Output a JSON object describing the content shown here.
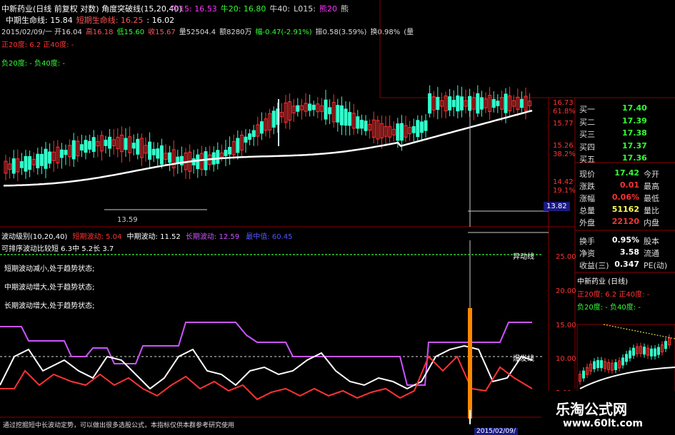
{
  "header": {
    "title": "中新药业(日线 前复权 对数) 角度突破线(15,20,40)",
    "ma_labels": [
      {
        "text": "牛15: 16.53",
        "color": "#ff33ff"
      },
      {
        "text": "牛20: 16.80",
        "color": "#33ff33"
      },
      {
        "text": "牛40:",
        "color": "#dddddd"
      },
      {
        "text": "L015:",
        "color": "#dddddd"
      },
      {
        "text": "熊20",
        "color": "#ff33ff"
      },
      {
        "text": "熊",
        "color": "#dddddd"
      }
    ],
    "line2": [
      {
        "text": "中期生命线: 15.84",
        "color": "#ffffff"
      },
      {
        "text": "短期生命线: 16.25",
        "color": "#ff5555"
      },
      {
        "text": ": 16.02",
        "color": "#ffffff"
      }
    ],
    "ohlc": [
      {
        "text": "2015/02/09/一 开16.04",
        "color": "#dddddd"
      },
      {
        "text": "高16.18",
        "color": "#ff5555"
      },
      {
        "text": "低15.60",
        "color": "#33ff33"
      },
      {
        "text": "收15.67",
        "color": "#ff5555"
      },
      {
        "text": "量52504.4",
        "color": "#dddddd"
      },
      {
        "text": "额8280万",
        "color": "#dddddd"
      },
      {
        "text": "幅-0.47(-2.91%)",
        "color": "#33ff33"
      },
      {
        "text": "振0.58(3.59%)",
        "color": "#dddddd"
      },
      {
        "text": "换0.98%",
        "color": "#dddddd"
      },
      {
        "text": "(量",
        "color": "#dddddd"
      }
    ],
    "line4": "正20度: 6.2 正40度: -",
    "line5": "负20度: - 负40度: -"
  },
  "main_chart": {
    "price_labels": [
      "16.73",
      "61.8%",
      "15.77",
      "15.26",
      "38.2%",
      "14.42",
      "19.1%",
      "13.82"
    ],
    "low_marker": "13.59"
  },
  "sub_chart": {
    "title": "波动级别(10,20,40)",
    "short_label": "短期波动: 5.04",
    "mid_label": "中期波动: 11.52",
    "long_label": "长期波动: 12.59",
    "extra_label": "最中值: 60.45",
    "rows": [
      "可排序波动比较短 6.3中 5.2长 3.7",
      "短期波动减小,处于趋势状态;",
      "中期波动增大,处于趋势状态;",
      "长期波动增大,处于趋势状态;"
    ],
    "yidong_label": "异动线",
    "baofa_label": "爆发线",
    "axis_labels": [
      "25.00",
      "20.00",
      "15.00",
      "10.00",
      "5.00"
    ],
    "footer": "通过挖掘短中长波动定势，可以做出很多选股公式，本指标仅供本群参考研究使用",
    "date_label": "2015/02/09/"
  },
  "quote_panel": {
    "bids": [
      {
        "label": "买一",
        "value": "17.40"
      },
      {
        "label": "买二",
        "value": "17.39"
      },
      {
        "label": "买三",
        "value": "17.38"
      },
      {
        "label": "买四",
        "value": "17.37"
      },
      {
        "label": "买五",
        "value": "17.36"
      }
    ],
    "stats": [
      {
        "label": "现价",
        "value": "17.42",
        "label2": "今开",
        "color": "#33ff33"
      },
      {
        "label": "涨跌",
        "value": "0.01",
        "label2": "最高",
        "color": "#ff3333"
      },
      {
        "label": "涨幅",
        "value": "0.06%",
        "label2": "最低",
        "color": "#ff3333"
      },
      {
        "label": "总量",
        "value": "51162",
        "label2": "量比",
        "color": "#ffff55"
      },
      {
        "label": "外盘",
        "value": "22120",
        "label2": "内盘",
        "color": "#ff3333"
      }
    ],
    "stats2": [
      {
        "label": "换手",
        "value": "0.95%",
        "label2": "股本"
      },
      {
        "label": "净资",
        "value": "3.58",
        "label2": "流通"
      },
      {
        "label": "收益(三)",
        "value": "0.347",
        "label2": "PE(动)"
      }
    ]
  },
  "mini_chart": {
    "title": "中新药业 (日线)",
    "line1": "正20度: 6.2 正40度: -",
    "line2": "负20度: - 负40度: -"
  },
  "watermark": {
    "cn": "乐淘公式网",
    "url": "www.60lt.com"
  }
}
